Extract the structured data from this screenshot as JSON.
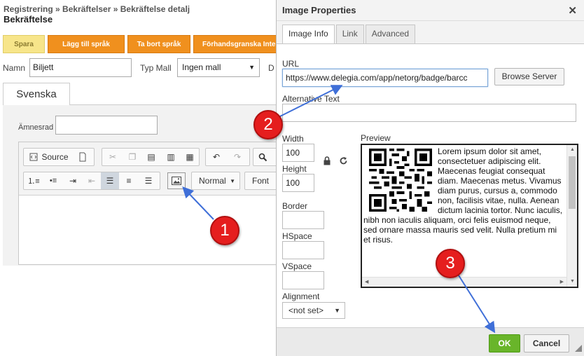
{
  "page": {
    "breadcrumb": "Registrering » Bekräftelser » Bekräftelse detalj",
    "title": "Bekräftelse",
    "actions": [
      "Spara",
      "Lägg till språk",
      "Ta bort språk",
      "Förhandsgranska Inter"
    ],
    "name_label": "Namn",
    "name_value": "Biljett",
    "type_label": "Typ Mall",
    "type_value": "Ingen mall",
    "type_extra_label": "D",
    "language_tab": "Svenska",
    "subject_label": "Ämnesrad",
    "subject_value": ""
  },
  "editor": {
    "source_label": "Source",
    "format_label": "Normal",
    "font_label": "Font"
  },
  "dialog": {
    "title": "Image Properties",
    "tabs": [
      "Image Info",
      "Link",
      "Advanced"
    ],
    "url_label": "URL",
    "url_value": "https://www.delegia.com/app/netorg/badge/barcc",
    "browse_label": "Browse Server",
    "alt_label": "Alternative Text",
    "alt_value": "",
    "width_label": "Width",
    "width_value": "100",
    "height_label": "Height",
    "height_value": "100",
    "border_label": "Border",
    "hspace_label": "HSpace",
    "vspace_label": "VSpace",
    "alignment_label": "Alignment",
    "alignment_value": "<not set>",
    "preview_label": "Preview",
    "preview_text": "Lorem ipsum dolor sit amet, consectetuer adipiscing elit. Maecenas feugiat consequat diam. Maecenas metus. Vivamus diam purus, cursus a, commodo non, facilisis vitae, nulla. Aenean dictum lacinia tortor. Nunc iaculis, nibh non iaculis aliquam, orci felis euismod neque, sed ornare massa mauris sed velit. Nulla pretium mi et risus.",
    "ok_label": "OK",
    "cancel_label": "Cancel",
    "close_glyph": "✕"
  },
  "annotations": {
    "steps": [
      "1",
      "2",
      "3"
    ],
    "badge_color": "#e51e1e",
    "arrow_color": "#3f6fd8"
  },
  "colors": {
    "orange_button": "#f0901e",
    "save_button": "#f7e58a",
    "ok_button": "#69b52a"
  }
}
